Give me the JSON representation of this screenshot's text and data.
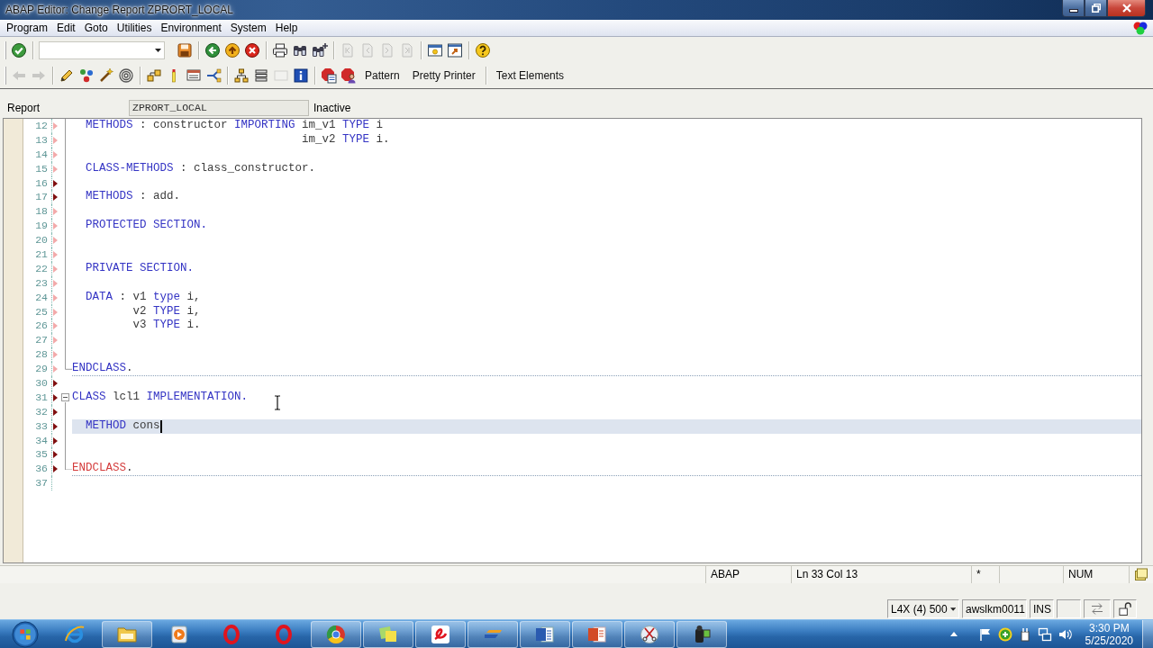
{
  "window": {
    "title": "ABAP Editor: Change Report ZPRORT_LOCAL"
  },
  "menu": [
    "Program",
    "Edit",
    "Goto",
    "Utilities",
    "Environment",
    "System",
    "Help"
  ],
  "standard_toolbar": {
    "groups": [
      [
        {
          "kind": "enter",
          "disabled": false
        }
      ],
      [
        {
          "kind": "save",
          "disabled": false
        }
      ],
      [
        {
          "kind": "back",
          "disabled": false
        },
        {
          "kind": "exit",
          "disabled": false
        },
        {
          "kind": "cancel",
          "disabled": false
        }
      ],
      [
        {
          "kind": "print",
          "disabled": false
        },
        {
          "kind": "find",
          "disabled": false
        },
        {
          "kind": "find-next",
          "disabled": false
        }
      ],
      [
        {
          "kind": "first-page",
          "disabled": true
        },
        {
          "kind": "previous-page",
          "disabled": true
        },
        {
          "kind": "next-page",
          "disabled": true
        },
        {
          "kind": "last-page",
          "disabled": true
        }
      ],
      [
        {
          "kind": "new-session",
          "disabled": false
        },
        {
          "kind": "shortcut",
          "disabled": false
        }
      ],
      [
        {
          "kind": "help",
          "disabled": false
        }
      ]
    ]
  },
  "application_toolbar": {
    "groups": [
      [
        {
          "kind": "back-arrow",
          "disabled": true
        },
        {
          "kind": "forward-arrow",
          "disabled": true
        }
      ],
      [
        {
          "kind": "display-change",
          "disabled": false
        },
        {
          "kind": "check",
          "disabled": false
        },
        {
          "kind": "activate",
          "disabled": false
        },
        {
          "kind": "test",
          "disabled": false
        }
      ],
      [
        {
          "kind": "where-used",
          "disabled": false
        },
        {
          "kind": "marker",
          "disabled": false
        },
        {
          "kind": "object-list",
          "disabled": false
        },
        {
          "kind": "navigation",
          "disabled": false
        }
      ],
      [
        {
          "kind": "hierarchy",
          "disabled": false
        },
        {
          "kind": "stack",
          "disabled": false
        },
        {
          "kind": "frame",
          "disabled": true
        },
        {
          "kind": "info",
          "disabled": false
        }
      ],
      [
        {
          "kind": "stop-document",
          "disabled": false
        },
        {
          "kind": "stop-person",
          "disabled": false
        },
        {
          "kind": "text",
          "label": "Pattern",
          "disabled": false
        },
        {
          "kind": "text",
          "label": "Pretty Printer",
          "disabled": false
        }
      ],
      [
        {
          "kind": "text",
          "label": "Text Elements",
          "disabled": false
        }
      ]
    ]
  },
  "header": {
    "label": "Report",
    "program": "ZPRORT_LOCAL",
    "status": "Inactive"
  },
  "editor": {
    "lines": [
      {
        "number": "12",
        "color": "#f2aaaa",
        "kind": "inner",
        "current": false,
        "code": [
          {
            "text": "  METHODS",
            "kind": "keyword"
          },
          {
            "text": " : constructor ",
            "kind": "plain"
          },
          {
            "text": "IMPORTING",
            "kind": "keyword"
          },
          {
            "text": " im_v1 ",
            "kind": "plain"
          },
          {
            "text": "TYPE",
            "kind": "keyword"
          },
          {
            "text": " i",
            "kind": "plain"
          }
        ]
      },
      {
        "number": "13",
        "color": "#f2aaaa",
        "kind": "inner",
        "current": false,
        "code": [
          {
            "text": "                                  im_v2 ",
            "kind": "plain"
          },
          {
            "text": "TYPE",
            "kind": "keyword"
          },
          {
            "text": " i.",
            "kind": "plain"
          }
        ]
      },
      {
        "number": "14",
        "color": "#f2aaaa",
        "kind": "inner",
        "current": false
      },
      {
        "number": "15",
        "color": "#f2aaaa",
        "kind": "inner",
        "current": false,
        "code": [
          {
            "text": "  CLASS-METHODS",
            "kind": "keyword"
          },
          {
            "text": " : class_constructor.",
            "kind": "plain"
          }
        ]
      },
      {
        "number": "16",
        "color": "#801010",
        "kind": "inner",
        "current": false
      },
      {
        "number": "17",
        "color": "#801010",
        "kind": "inner",
        "current": false,
        "code": [
          {
            "text": "  METHODS",
            "kind": "keyword"
          },
          {
            "text": " : add.",
            "kind": "plain"
          }
        ]
      },
      {
        "number": "18",
        "color": "#f2aaaa",
        "kind": "inner",
        "current": false
      },
      {
        "number": "19",
        "color": "#f2aaaa",
        "kind": "inner",
        "current": false,
        "code": [
          {
            "text": "  PROTECTED SECTION.",
            "kind": "keyword"
          }
        ]
      },
      {
        "number": "20",
        "color": "#f2aaaa",
        "kind": "inner",
        "current": false
      },
      {
        "number": "21",
        "color": "#f2aaaa",
        "kind": "inner",
        "current": false
      },
      {
        "number": "22",
        "color": "#f2aaaa",
        "kind": "inner",
        "current": false,
        "code": [
          {
            "text": "  PRIVATE SECTION.",
            "kind": "keyword"
          }
        ]
      },
      {
        "number": "23",
        "color": "#f2aaaa",
        "kind": "inner",
        "current": false
      },
      {
        "number": "24",
        "color": "#f2aaaa",
        "kind": "inner",
        "current": false,
        "code": [
          {
            "text": "  DATA",
            "kind": "keyword"
          },
          {
            "text": " : v1 ",
            "kind": "plain"
          },
          {
            "text": "type",
            "kind": "keyword"
          },
          {
            "text": " i,",
            "kind": "plain"
          }
        ]
      },
      {
        "number": "25",
        "color": "#f2aaaa",
        "kind": "inner",
        "current": false,
        "code": [
          {
            "text": "         v2 ",
            "kind": "plain"
          },
          {
            "text": "TYPE",
            "kind": "keyword"
          },
          {
            "text": " i,",
            "kind": "plain"
          }
        ]
      },
      {
        "number": "26",
        "color": "#f2aaaa",
        "kind": "inner",
        "current": false,
        "code": [
          {
            "text": "         v3 ",
            "kind": "plain"
          },
          {
            "text": "TYPE",
            "kind": "keyword"
          },
          {
            "text": " i.",
            "kind": "plain"
          }
        ]
      },
      {
        "number": "27",
        "color": "#f2aaaa",
        "kind": "inner",
        "current": false
      },
      {
        "number": "28",
        "color": "#f2aaaa",
        "kind": "inner",
        "current": false
      },
      {
        "number": "29",
        "color": "#f2aaaa",
        "kind": "close",
        "current": false,
        "code": [
          {
            "text": "ENDCLASS",
            "kind": "keyword"
          },
          {
            "text": ".",
            "kind": "plain"
          }
        ]
      },
      {
        "number": "30",
        "color": "#801010",
        "kind": "plain",
        "current": false
      },
      {
        "number": "31",
        "color": "#801010",
        "kind": "open",
        "current": false,
        "code": [
          {
            "text": "CLASS",
            "kind": "keyword"
          },
          {
            "text": " lcl1 ",
            "kind": "plain"
          },
          {
            "text": "IMPLEMENTATION.",
            "kind": "keyword"
          }
        ]
      },
      {
        "number": "32",
        "color": "#801010",
        "kind": "inner",
        "current": false
      },
      {
        "number": "33",
        "color": "#801010",
        "kind": "inner",
        "current": true,
        "code": [
          {
            "text": "  METHOD",
            "kind": "keyword"
          },
          {
            "text": " cons",
            "kind": "plain"
          }
        ]
      },
      {
        "number": "34",
        "color": "#801010",
        "kind": "inner",
        "current": false
      },
      {
        "number": "35",
        "color": "#801010",
        "kind": "inner",
        "current": false
      },
      {
        "number": "36",
        "color": "#801010",
        "kind": "close",
        "current": false,
        "code": [
          {
            "text": "ENDCLASS",
            "kind": "error"
          },
          {
            "text": ".",
            "kind": "plain"
          }
        ]
      },
      {
        "number": "37",
        "kind": "plain",
        "current": false
      }
    ]
  },
  "editor_status": {
    "language": "ABAP",
    "position": "Ln 33 Col 13",
    "changed_mark": "*",
    "num_lock": "NUM"
  },
  "sap_status": {
    "system": "L4X (4) 500",
    "server": "awslkm0011",
    "mode": "INS"
  },
  "taskbar": {
    "apps": [
      {
        "kind": "globe",
        "running": false
      },
      {
        "kind": "folder",
        "running": true
      },
      {
        "kind": "player",
        "running": false
      },
      {
        "kind": "ring",
        "running": false
      },
      {
        "kind": "ring",
        "running": false
      },
      {
        "kind": "ball",
        "running": true
      },
      {
        "kind": "notes",
        "running": true
      },
      {
        "kind": "swirl",
        "running": true
      },
      {
        "kind": "bars",
        "running": true
      },
      {
        "kind": "document",
        "running": true
      },
      {
        "kind": "slides",
        "running": true
      },
      {
        "kind": "scissors",
        "running": true
      },
      {
        "kind": "camcorder",
        "running": true
      }
    ],
    "clock": {
      "time": "3:30 PM",
      "date": "5/25/2020"
    }
  }
}
